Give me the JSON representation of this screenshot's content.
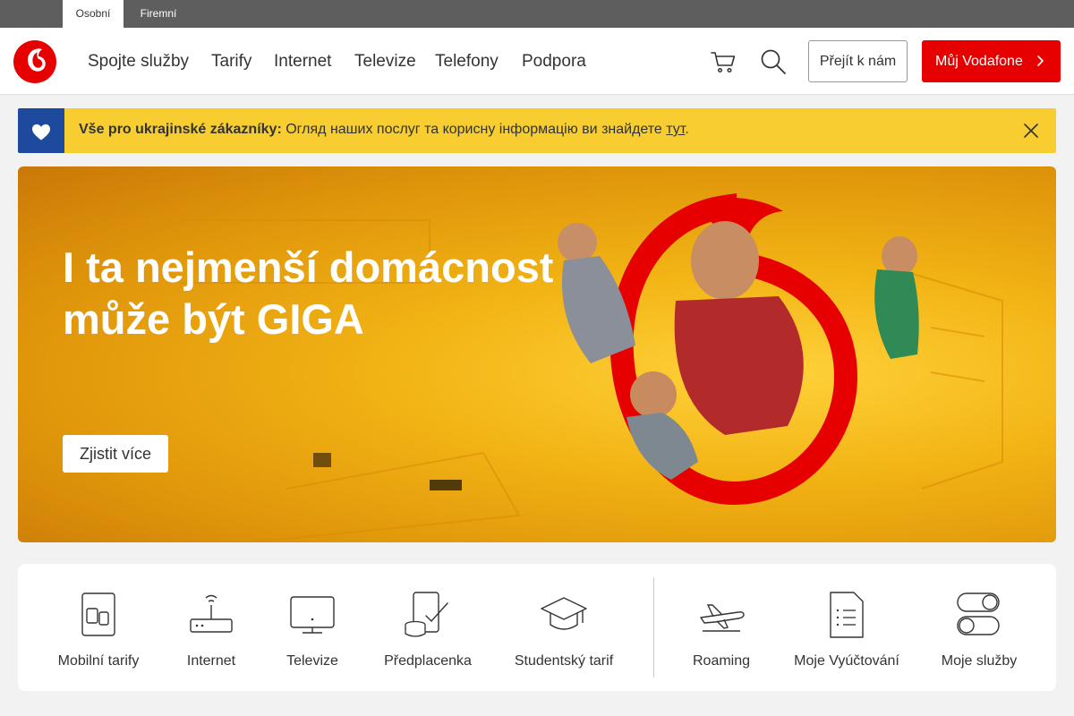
{
  "segments": {
    "personal": "Osobní",
    "business": "Firemní"
  },
  "nav": {
    "items": [
      "Spojte služby",
      "Tarify",
      "Internet",
      "Televize",
      "Telefony",
      "Podpora"
    ],
    "cart_icon": "cart-icon",
    "search_icon": "search-icon",
    "switch_label": "Přejít k nám",
    "account_label": "Můj Vodafone"
  },
  "banner": {
    "bold": "Vše pro ukrajinské zákazníky:",
    "text": "Огляд наших послуг та корисну інформацію ви знайдете",
    "link": "тут",
    "end": ".",
    "icon": "heart-icon"
  },
  "hero": {
    "title": "I ta nejmenší domácnost může být GIGA",
    "cta": "Zjistit více"
  },
  "quick_links": {
    "items": [
      {
        "label": "Mobilní tarify",
        "icon": "sim-card-icon"
      },
      {
        "label": "Internet",
        "icon": "router-icon"
      },
      {
        "label": "Televize",
        "icon": "tv-icon"
      },
      {
        "label": "Předplacenka",
        "icon": "prepaid-icon"
      },
      {
        "label": "Studentský tarif",
        "icon": "graduation-cap-icon"
      },
      {
        "label": "Roaming",
        "icon": "airplane-icon"
      },
      {
        "label": "Moje Vyúčtování",
        "icon": "bill-icon"
      },
      {
        "label": "Moje služby",
        "icon": "toggles-icon"
      }
    ]
  },
  "colors": {
    "brand_red": "#e60000",
    "banner_yellow": "#f7cd30",
    "banner_blue": "#1d4a9c"
  }
}
